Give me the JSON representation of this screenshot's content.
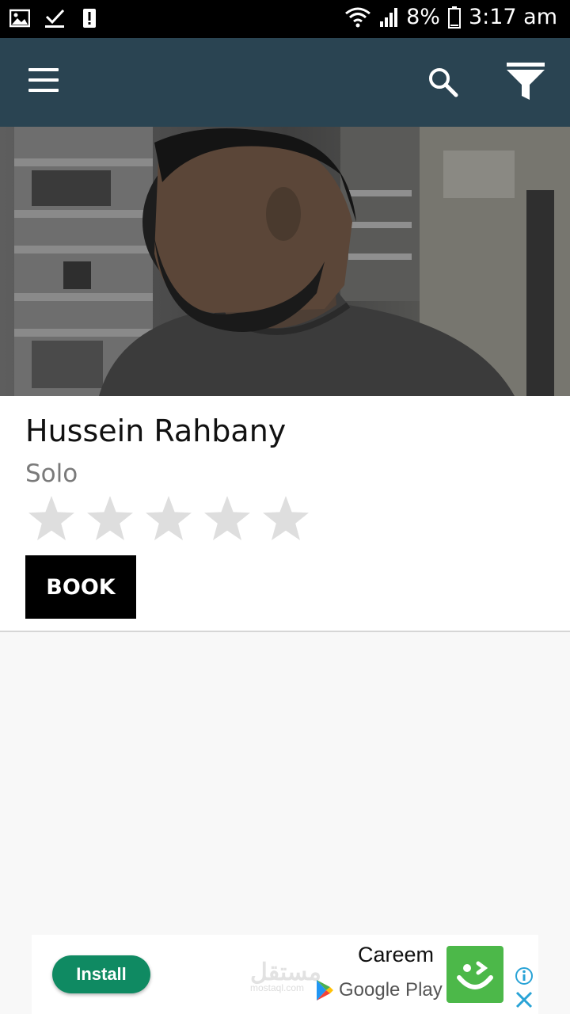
{
  "status_bar": {
    "battery": "8%",
    "time": "3:17 am",
    "icons": [
      "gallery-icon",
      "download-check-icon",
      "alert-icon",
      "wifi-icon",
      "signal-icon",
      "battery-icon"
    ]
  },
  "app_bar": {
    "background": "#2a4452",
    "icons": [
      "menu-icon",
      "search-icon",
      "filter-icon"
    ]
  },
  "artist": {
    "name": "Hussein Rahbany",
    "type": "Solo",
    "rating": 0,
    "rating_max": 5,
    "book_label": "BOOK"
  },
  "ad": {
    "install_label": "Install",
    "title": "Careem",
    "store_label": "Google Play",
    "accent": "#0f8a62",
    "logo_color": "#4cb849",
    "watermark": "مستقل",
    "watermark_sub": "mostaql.com"
  }
}
